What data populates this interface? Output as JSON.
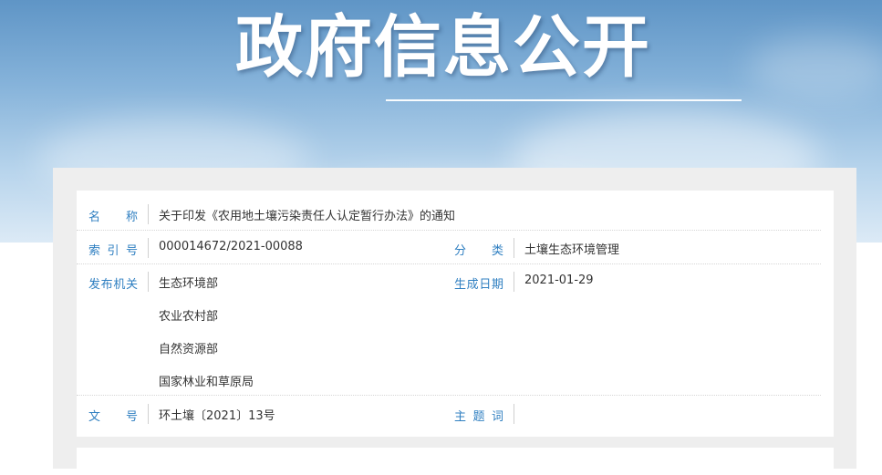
{
  "banner": {
    "title": "政府信息公开"
  },
  "info": {
    "name_label": "名称",
    "name_value": "关于印发《农用地土壤污染责任人认定暂行办法》的通知",
    "index_label": "索引号",
    "index_value": "000014672/2021-00088",
    "category_label": "分类",
    "category_value": "土壤生态环境管理",
    "publisher_label": "发布机关",
    "publishers": [
      "生态环境部",
      "农业农村部",
      "自然资源部",
      "国家林业和草原局"
    ],
    "date_label": "生成日期",
    "date_value": "2021-01-29",
    "docno_label": "文号",
    "docno_value": "环土壤〔2021〕13号",
    "keywords_label": "主题词",
    "keywords_value": ""
  }
}
